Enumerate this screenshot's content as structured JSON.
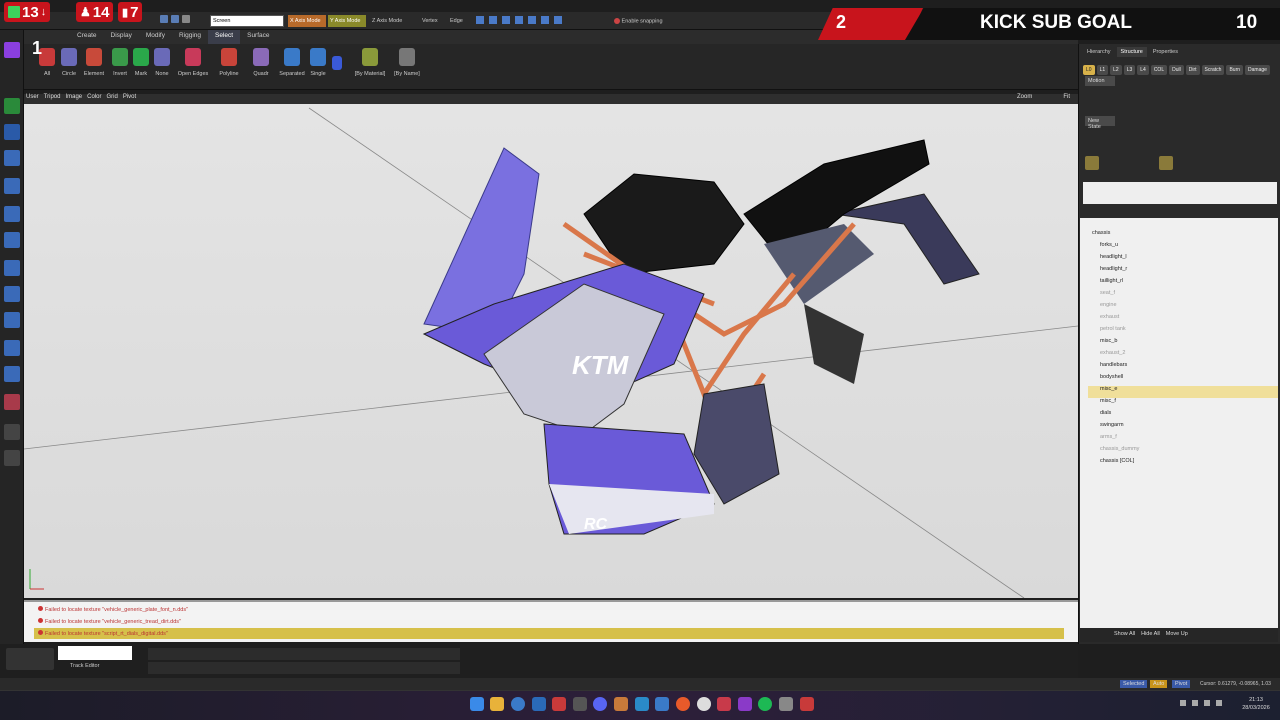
{
  "overlay": {
    "counter_a": "13",
    "counter_b": "14",
    "counter_c": "7",
    "corner_number": "1",
    "goal_current": "2",
    "goal_label": "KICK SUB GOAL",
    "goal_target": "10"
  },
  "toolbar": {
    "search_value": "Screen",
    "x_axis_mode": "X Axis Mode",
    "y_axis_mode": "Y Axis Mode",
    "z_axis_mode": "Z Axis Mode",
    "vertex": "Vertex",
    "edge": "Edge",
    "enable_snapping": "Enable snapping"
  },
  "menu": [
    "Create",
    "Display",
    "Modify",
    "Rigging",
    "Select",
    "Surface"
  ],
  "ribbon": {
    "buttons": [
      "All",
      "Circle",
      "Element",
      "Invert",
      "Mark",
      "None",
      "Open Edges",
      "Polyline",
      "Quadr",
      "Separated",
      "Single",
      "[By Material]",
      "[By Name]"
    ]
  },
  "viewport": {
    "header_items": [
      "User",
      "Tripod",
      "Image",
      "Color",
      "Grid",
      "Pivot"
    ],
    "zoom_label": "Zoom",
    "fit_label": "Fit"
  },
  "console": {
    "lines": [
      "Failed to locate texture \"vehicle_generic_plate_font_n.dds\"",
      "Failed to locate texture \"vehicle_generic_tread_dirt.dds\"",
      "Failed to locate texture \"script_rt_dials_digital.dds\""
    ]
  },
  "bottom": {
    "track_editor": "Track Editor"
  },
  "right_panel": {
    "tabs": [
      "Hierarchy",
      "Structure",
      "Properties"
    ],
    "chips": [
      "L0",
      "L1",
      "L2",
      "L3",
      "L4",
      "COL",
      "Dull",
      "Dirt",
      "Scratch",
      "Burn",
      "Damage"
    ],
    "motion": "Motion",
    "new_state": "New State",
    "tree": [
      {
        "label": "chassis",
        "dim": false,
        "sel": false,
        "indent": 0
      },
      {
        "label": "forks_u",
        "dim": false,
        "sel": false,
        "indent": 1
      },
      {
        "label": "headlight_l",
        "dim": false,
        "sel": false,
        "indent": 1
      },
      {
        "label": "headlight_r",
        "dim": false,
        "sel": false,
        "indent": 1
      },
      {
        "label": "taillight_rl",
        "dim": false,
        "sel": false,
        "indent": 1
      },
      {
        "label": "seat_f",
        "dim": true,
        "sel": false,
        "indent": 1
      },
      {
        "label": "engine",
        "dim": true,
        "sel": false,
        "indent": 1
      },
      {
        "label": "exhaust",
        "dim": true,
        "sel": false,
        "indent": 1
      },
      {
        "label": "petrol tank",
        "dim": true,
        "sel": false,
        "indent": 1
      },
      {
        "label": "misc_b",
        "dim": false,
        "sel": false,
        "indent": 1
      },
      {
        "label": "exhaust_2",
        "dim": true,
        "sel": false,
        "indent": 1
      },
      {
        "label": "handlebars",
        "dim": false,
        "sel": false,
        "indent": 1
      },
      {
        "label": "bodyshell",
        "dim": false,
        "sel": false,
        "indent": 1
      },
      {
        "label": "misc_e",
        "dim": false,
        "sel": true,
        "indent": 1
      },
      {
        "label": "misc_f",
        "dim": false,
        "sel": false,
        "indent": 1
      },
      {
        "label": "dials",
        "dim": false,
        "sel": false,
        "indent": 1
      },
      {
        "label": "swingarm",
        "dim": false,
        "sel": false,
        "indent": 1
      },
      {
        "label": "arms_f",
        "dim": true,
        "sel": false,
        "indent": 1
      },
      {
        "label": "chassis_dummy",
        "dim": true,
        "sel": false,
        "indent": 1
      },
      {
        "label": "chassis [COL]",
        "dim": false,
        "sel": false,
        "indent": 1
      }
    ],
    "footer": [
      "Show All",
      "Hide All",
      "Move Up"
    ]
  },
  "status": {
    "selected": "Selected",
    "auto": "Auto",
    "pivot": "Pivot",
    "cursor": "Cursor: 0.61279, -0.08965, 1.03"
  },
  "taskbar": {
    "time": "21:13",
    "date": "28/03/2026"
  },
  "colors": {
    "accent_red": "#c8141c",
    "selection_yellow": "#f0df9a",
    "livery_purple": "#6a5ad8",
    "frame_orange": "#d9774a"
  }
}
